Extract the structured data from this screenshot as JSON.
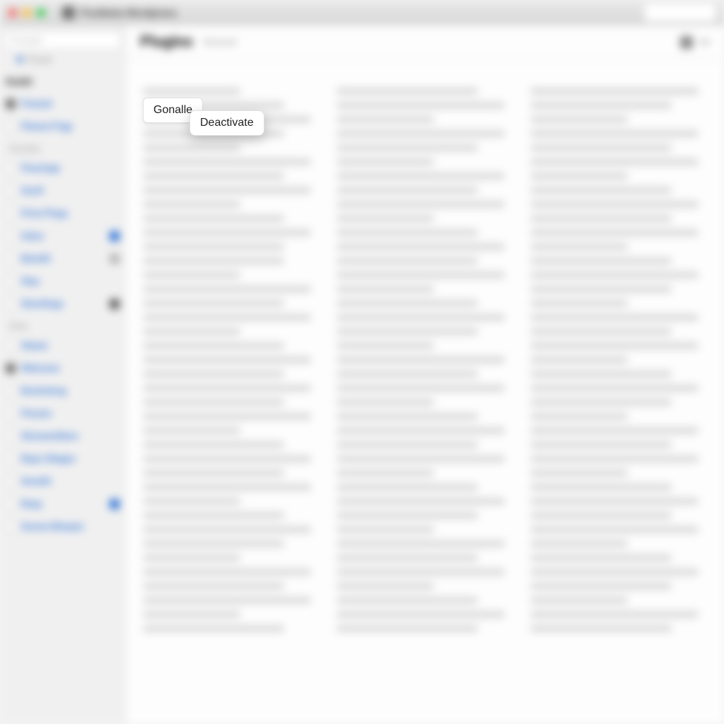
{
  "titlebar": {
    "title": "Postbeta Wordpress"
  },
  "sidebar": {
    "search_placeholder": "Proceed",
    "hint": "Proced",
    "section_title": "Reddit",
    "group_favorites": "Favorites",
    "group_fixed": "Fixed",
    "items_top": [
      {
        "label": "Freeset",
        "checked": true
      },
      {
        "label": "Plaresi Frigy",
        "checked": false
      }
    ],
    "items_fav": [
      {
        "label": "Flouringe",
        "checked": false,
        "badge": null
      },
      {
        "label": "Sooft",
        "checked": false,
        "badge": null
      },
      {
        "label": "Prise Plugs",
        "checked": false,
        "badge": null
      },
      {
        "label": "Inbox",
        "checked": false,
        "badge": "blue"
      },
      {
        "label": "Benefit",
        "checked": false,
        "badge": "grey"
      },
      {
        "label": "Stay",
        "checked": false,
        "badge": null
      },
      {
        "label": "Shortlings",
        "checked": false,
        "badge": "dark"
      }
    ],
    "items_fixed": [
      {
        "label": "Steam",
        "checked": false
      },
      {
        "label": "Welcome",
        "checked": true
      },
      {
        "label": "Bostrelong",
        "checked": false
      },
      {
        "label": "Peoses",
        "checked": false
      },
      {
        "label": "Stronemillens",
        "checked": false
      },
      {
        "label": "Repo Ollages",
        "checked": false
      },
      {
        "label": "Smoltit",
        "checked": false
      },
      {
        "label": "Reep",
        "checked": false,
        "badge": "blue"
      },
      {
        "label": "Soreve Bloepst",
        "checked": false
      }
    ]
  },
  "main": {
    "title": "Plugins",
    "subtitle": "General"
  },
  "popover": {
    "button_label": "Gonalle",
    "menu_label": "Deactivate"
  }
}
